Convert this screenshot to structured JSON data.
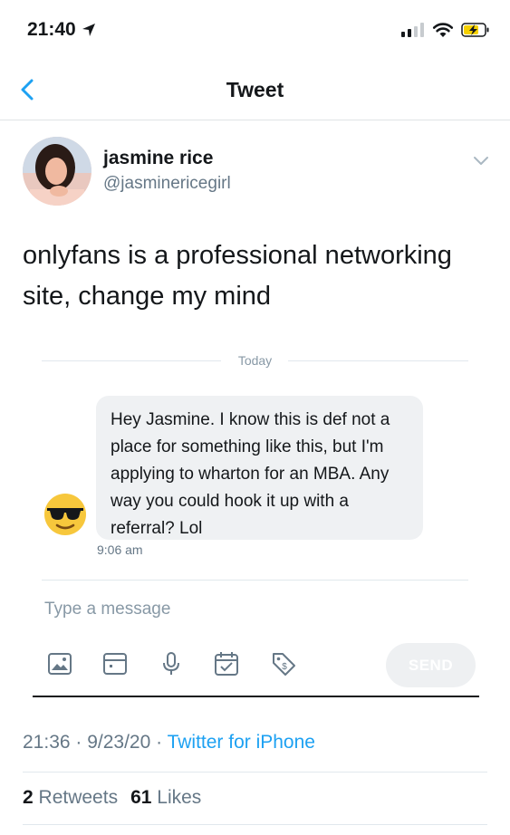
{
  "status_bar": {
    "time": "21:40"
  },
  "nav": {
    "title": "Tweet"
  },
  "tweet": {
    "author_name": "jasmine rice",
    "author_handle": "@jasminericegirl",
    "text": "onlyfans is a professional networking site, change my mind",
    "meta_time": "21:36 · 9/23/20 · ",
    "source": "Twitter for iPhone",
    "retweets_count": "2",
    "retweets_label": "Retweets",
    "likes_count": "61",
    "likes_label": "Likes"
  },
  "dm": {
    "day_label": "Today",
    "message": "Hey Jasmine. I know this is def not a place for something like this, but I'm applying to wharton for an MBA. Any way you could hook it up with a referral? Lol",
    "message_time": "9:06 am",
    "composer_placeholder": "Type a message",
    "send_label": "SEND"
  },
  "colors": {
    "accent": "#1da1f2",
    "secondary_text": "#657786",
    "bubble": "#eff1f3"
  }
}
